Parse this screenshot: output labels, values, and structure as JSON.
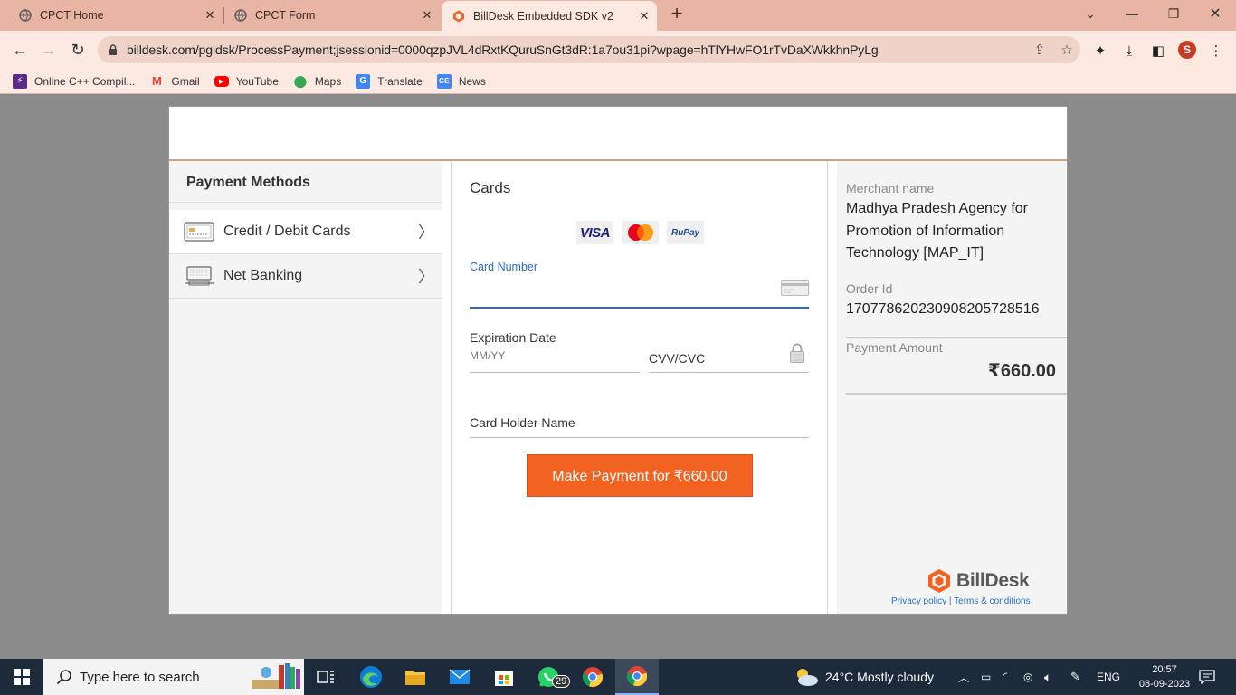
{
  "browser": {
    "tabs": [
      {
        "title": "CPCT Home",
        "active": false
      },
      {
        "title": "CPCT Form",
        "active": false
      },
      {
        "title": "BillDesk Embedded SDK v2",
        "active": true
      }
    ],
    "url": "billdesk.com/pgidsk/ProcessPayment;jsessionid=0000qzpJVL4dRxtKQuruSnGt3dR:1a7ou31pi?wpage=hTlYHwFO1rTvDaXWkkhnPyLg",
    "profile_initial": "S",
    "bookmarks": [
      {
        "label": "Online C++ Compil...",
        "icon": "code-icon",
        "color": "#5b2a86"
      },
      {
        "label": "Gmail",
        "icon": "gmail-icon",
        "color": "#ea4335"
      },
      {
        "label": "YouTube",
        "icon": "youtube-icon",
        "color": "#ff0000"
      },
      {
        "label": "Maps",
        "icon": "maps-icon",
        "color": "#34a853"
      },
      {
        "label": "Translate",
        "icon": "translate-icon",
        "color": "#4285f4"
      },
      {
        "label": "News",
        "icon": "news-icon",
        "color": "#4285f4"
      }
    ]
  },
  "payment": {
    "methods_title": "Payment Methods",
    "methods": [
      {
        "label": "Credit / Debit Cards",
        "active": true
      },
      {
        "label": "Net Banking",
        "active": false
      }
    ],
    "cards_title": "Cards",
    "card_brands": [
      "VISA",
      "mastercard",
      "RuPay"
    ],
    "card_number_label": "Card Number",
    "card_number_value": "",
    "expiry_label": "Expiration Date",
    "expiry_placeholder": "MM/YY",
    "cvv_label": "CVV/CVC",
    "holder_label": "Card Holder Name",
    "pay_button": "Make Payment for ₹660.00"
  },
  "summary": {
    "merchant_label": "Merchant name",
    "merchant_value": "Madhya Pradesh Agency for Promotion of Information Technology [MAP_IT]",
    "order_label": "Order Id",
    "order_value": "17077862023090820572851‌6",
    "amount_label": "Payment Amount",
    "amount_value": "₹660.00",
    "brand": "BillDesk",
    "privacy_link": "Privacy policy",
    "link_sep": "|",
    "terms_link": "Terms & conditions"
  },
  "taskbar": {
    "search_placeholder": "Type here to search",
    "whatsapp_badge": "29",
    "weather": "24°C  Mostly cloudy",
    "language": "ENG",
    "time": "20:57",
    "date": "08-09-2023"
  },
  "colors": {
    "accent": "#f26322",
    "link": "#2a6ebb",
    "tabbar": "#e8b4a4"
  }
}
